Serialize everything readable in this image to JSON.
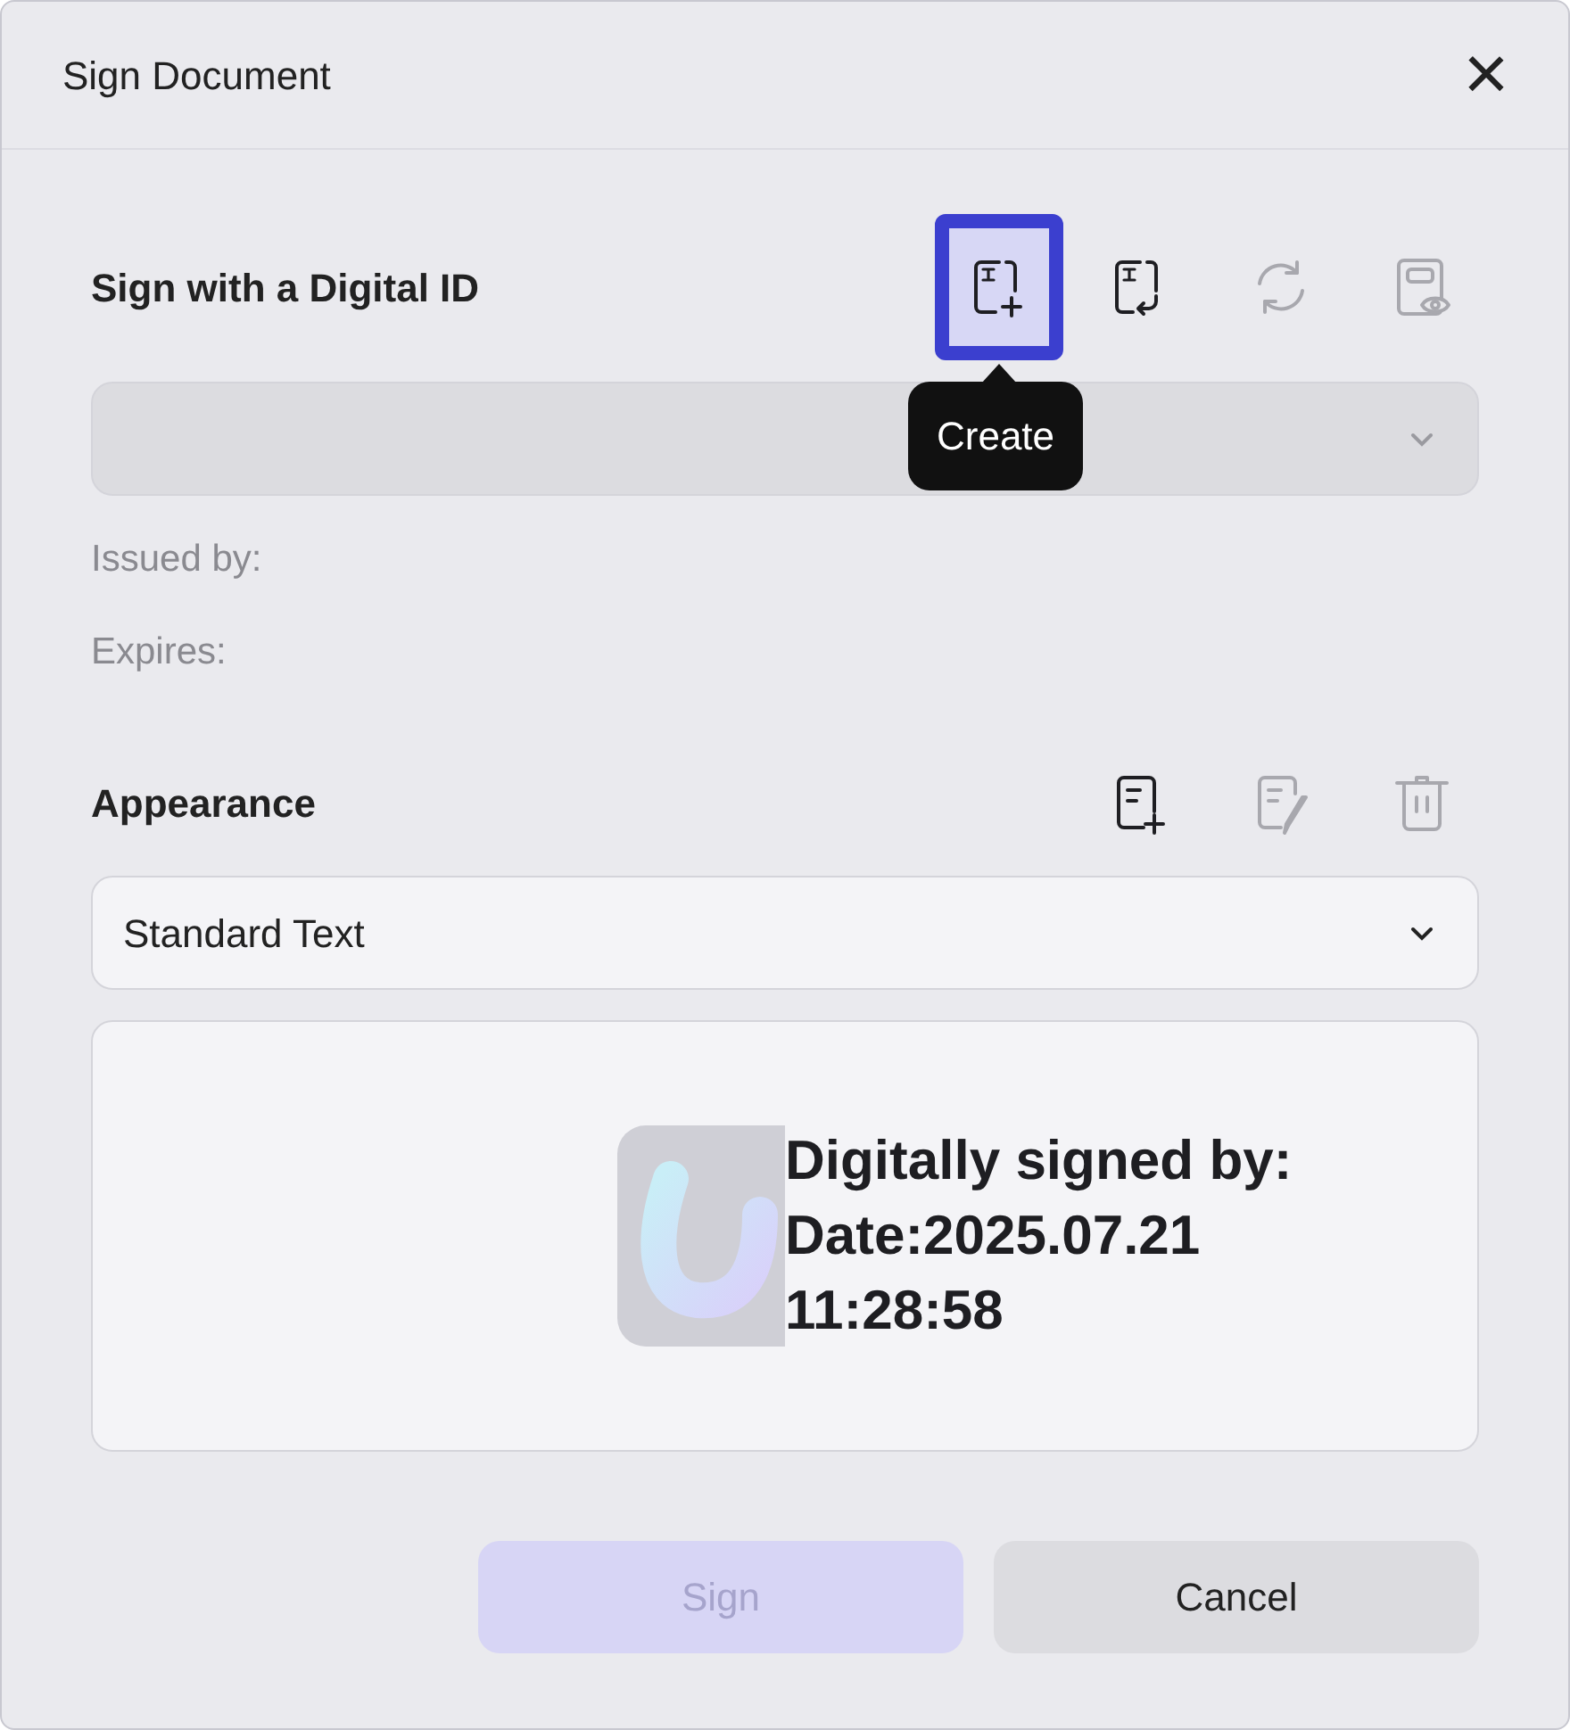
{
  "window": {
    "title": "Sign Document",
    "close": "×"
  },
  "digital_id": {
    "heading": "Sign with a Digital ID",
    "tools": [
      {
        "kind": "create",
        "disabled": false,
        "selected": true
      },
      {
        "kind": "import",
        "disabled": false,
        "selected": false
      },
      {
        "kind": "refresh",
        "disabled": true,
        "selected": false
      },
      {
        "kind": "preview",
        "disabled": true,
        "selected": false
      }
    ],
    "tooltip": "Create",
    "dropdown": {
      "disabled": true
    },
    "issued_by": "Issued by:",
    "expires": "Expires:"
  },
  "appearance": {
    "heading": "Appearance",
    "tools": [
      {
        "kind": "add",
        "disabled": false,
        "selected": false
      },
      {
        "kind": "edit",
        "disabled": true,
        "selected": false
      },
      {
        "kind": "delete",
        "disabled": true,
        "selected": false
      }
    ],
    "dropdown": {
      "value": "Standard Text",
      "disabled": false
    },
    "preview": [
      "Digitally signed by:",
      "Date:2025.07.21",
      "11:28:58"
    ]
  },
  "buttons": [
    {
      "label": "Sign",
      "disabled": true,
      "kind": "primary"
    },
    {
      "label": "Cancel",
      "disabled": false,
      "kind": "secondary"
    }
  ]
}
